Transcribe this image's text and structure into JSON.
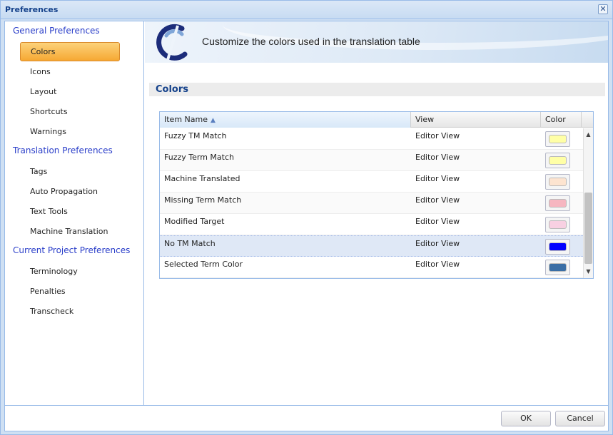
{
  "window": {
    "title": "Preferences"
  },
  "sidebar": {
    "groups": [
      {
        "label": "General Preferences",
        "items": [
          "Colors",
          "Icons",
          "Layout",
          "Shortcuts",
          "Warnings"
        ]
      },
      {
        "label": "Translation Preferences",
        "items": [
          "Tags",
          "Auto Propagation",
          "Text Tools",
          "Machine Translation"
        ]
      },
      {
        "label": "Current Project Preferences",
        "items": [
          "Terminology",
          "Penalties",
          "Transcheck"
        ]
      }
    ],
    "active_item": "Colors"
  },
  "banner": {
    "heading": "Customize the colors used in the translation table"
  },
  "section": {
    "title": "Colors"
  },
  "grid": {
    "columns": [
      "Item Name",
      "View",
      "Color"
    ],
    "sorted_column": "Item Name",
    "sort_direction": "ascending",
    "rows": [
      {
        "name": "Fuzzy TM Match",
        "view": "Editor View",
        "color": "#ffffa6"
      },
      {
        "name": "Fuzzy Term Match",
        "view": "Editor View",
        "color": "#ffffa6"
      },
      {
        "name": "Machine Translated",
        "view": "Editor View",
        "color": "#fde4d0"
      },
      {
        "name": "Missing Term Match",
        "view": "Editor View",
        "color": "#f6b6c0"
      },
      {
        "name": "Modified Target",
        "view": "Editor View",
        "color": "#f8d0e2"
      },
      {
        "name": "No TM Match",
        "view": "Editor View",
        "color": "#0000ff"
      },
      {
        "name": "Selected Term Color",
        "view": "Editor View",
        "color": "#3a6ea5"
      }
    ],
    "selected_row": "No TM Match"
  },
  "footer": {
    "ok_label": "OK",
    "cancel_label": "Cancel"
  }
}
